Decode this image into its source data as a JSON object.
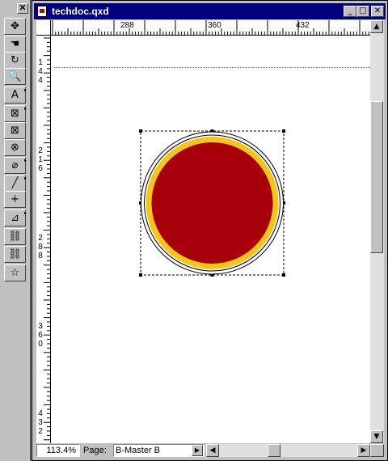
{
  "palette": {
    "close_label": "✕",
    "tools": [
      {
        "name": "item-tool-icon",
        "glyph": "✥"
      },
      {
        "name": "content-tool-icon",
        "glyph": "☚"
      },
      {
        "name": "rotation-tool-icon",
        "glyph": "↻"
      },
      {
        "name": "zoom-tool-icon",
        "glyph": "🔍"
      },
      {
        "name": "text-box-tool-icon",
        "glyph": "A"
      },
      {
        "name": "rectangle-picture-box-tool-icon",
        "glyph": "⊠"
      },
      {
        "name": "rounded-picture-box-tool-icon",
        "glyph": "⊠"
      },
      {
        "name": "oval-picture-box-tool-icon",
        "glyph": "⊗"
      },
      {
        "name": "bezier-picture-box-tool-icon",
        "glyph": "⌀"
      },
      {
        "name": "line-tool-icon",
        "glyph": "╱"
      },
      {
        "name": "orthogonal-line-tool-icon",
        "glyph": "+"
      },
      {
        "name": "text-path-tool-icon",
        "glyph": "⊿"
      },
      {
        "name": "linking-tool-icon",
        "glyph": "⛓"
      },
      {
        "name": "unlinking-tool-icon",
        "glyph": "⛓"
      },
      {
        "name": "star-tool-icon",
        "glyph": "☆"
      }
    ]
  },
  "window": {
    "title": "techdoc.qxd",
    "minimize_label": "_",
    "maximize_label": "□",
    "close_label": "✕"
  },
  "rulers": {
    "horizontal": [
      "288",
      "360",
      "432"
    ],
    "vertical": [
      [
        "1",
        "4",
        "4"
      ],
      [
        "2",
        "1",
        "6"
      ],
      [
        "2",
        "8",
        "8"
      ],
      [
        "3",
        "6",
        "0"
      ],
      [
        "4",
        "3",
        "2"
      ]
    ]
  },
  "status": {
    "zoom": "113.4%",
    "page_label": "Page:",
    "page_value": "B-Master B"
  },
  "colors": {
    "circle_fill": "#a8000a",
    "circle_ring": "#f5c518",
    "titlebar": "#000080"
  }
}
